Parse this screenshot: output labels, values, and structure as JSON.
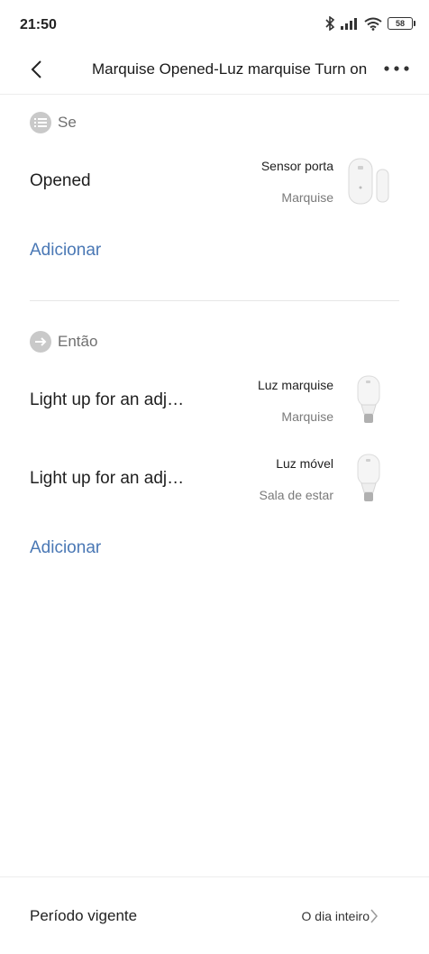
{
  "status_bar": {
    "time": "21:50",
    "battery": "58"
  },
  "header": {
    "title": "Marquise Opened-Luz marquise Turn on"
  },
  "condition": {
    "label": "Se",
    "items": [
      {
        "label": "Opened",
        "device": "Sensor porta",
        "room": "Marquise",
        "icon": "door-sensor-icon"
      }
    ],
    "add_label": "Adicionar"
  },
  "action": {
    "label": "Então",
    "items": [
      {
        "label": "Light up for an adj…",
        "device": "Luz marquise",
        "room": "Marquise",
        "icon": "smart-bulb-icon"
      },
      {
        "label": "Light up for an adj…",
        "device": "Luz móvel",
        "room": "Sala de estar",
        "icon": "smart-bulb-icon"
      }
    ],
    "add_label": "Adicionar"
  },
  "footer": {
    "label": "Período vigente",
    "value": "O dia inteiro"
  },
  "colors": {
    "accent": "#4a78b5",
    "icon_gray": "#c9c9c9"
  }
}
